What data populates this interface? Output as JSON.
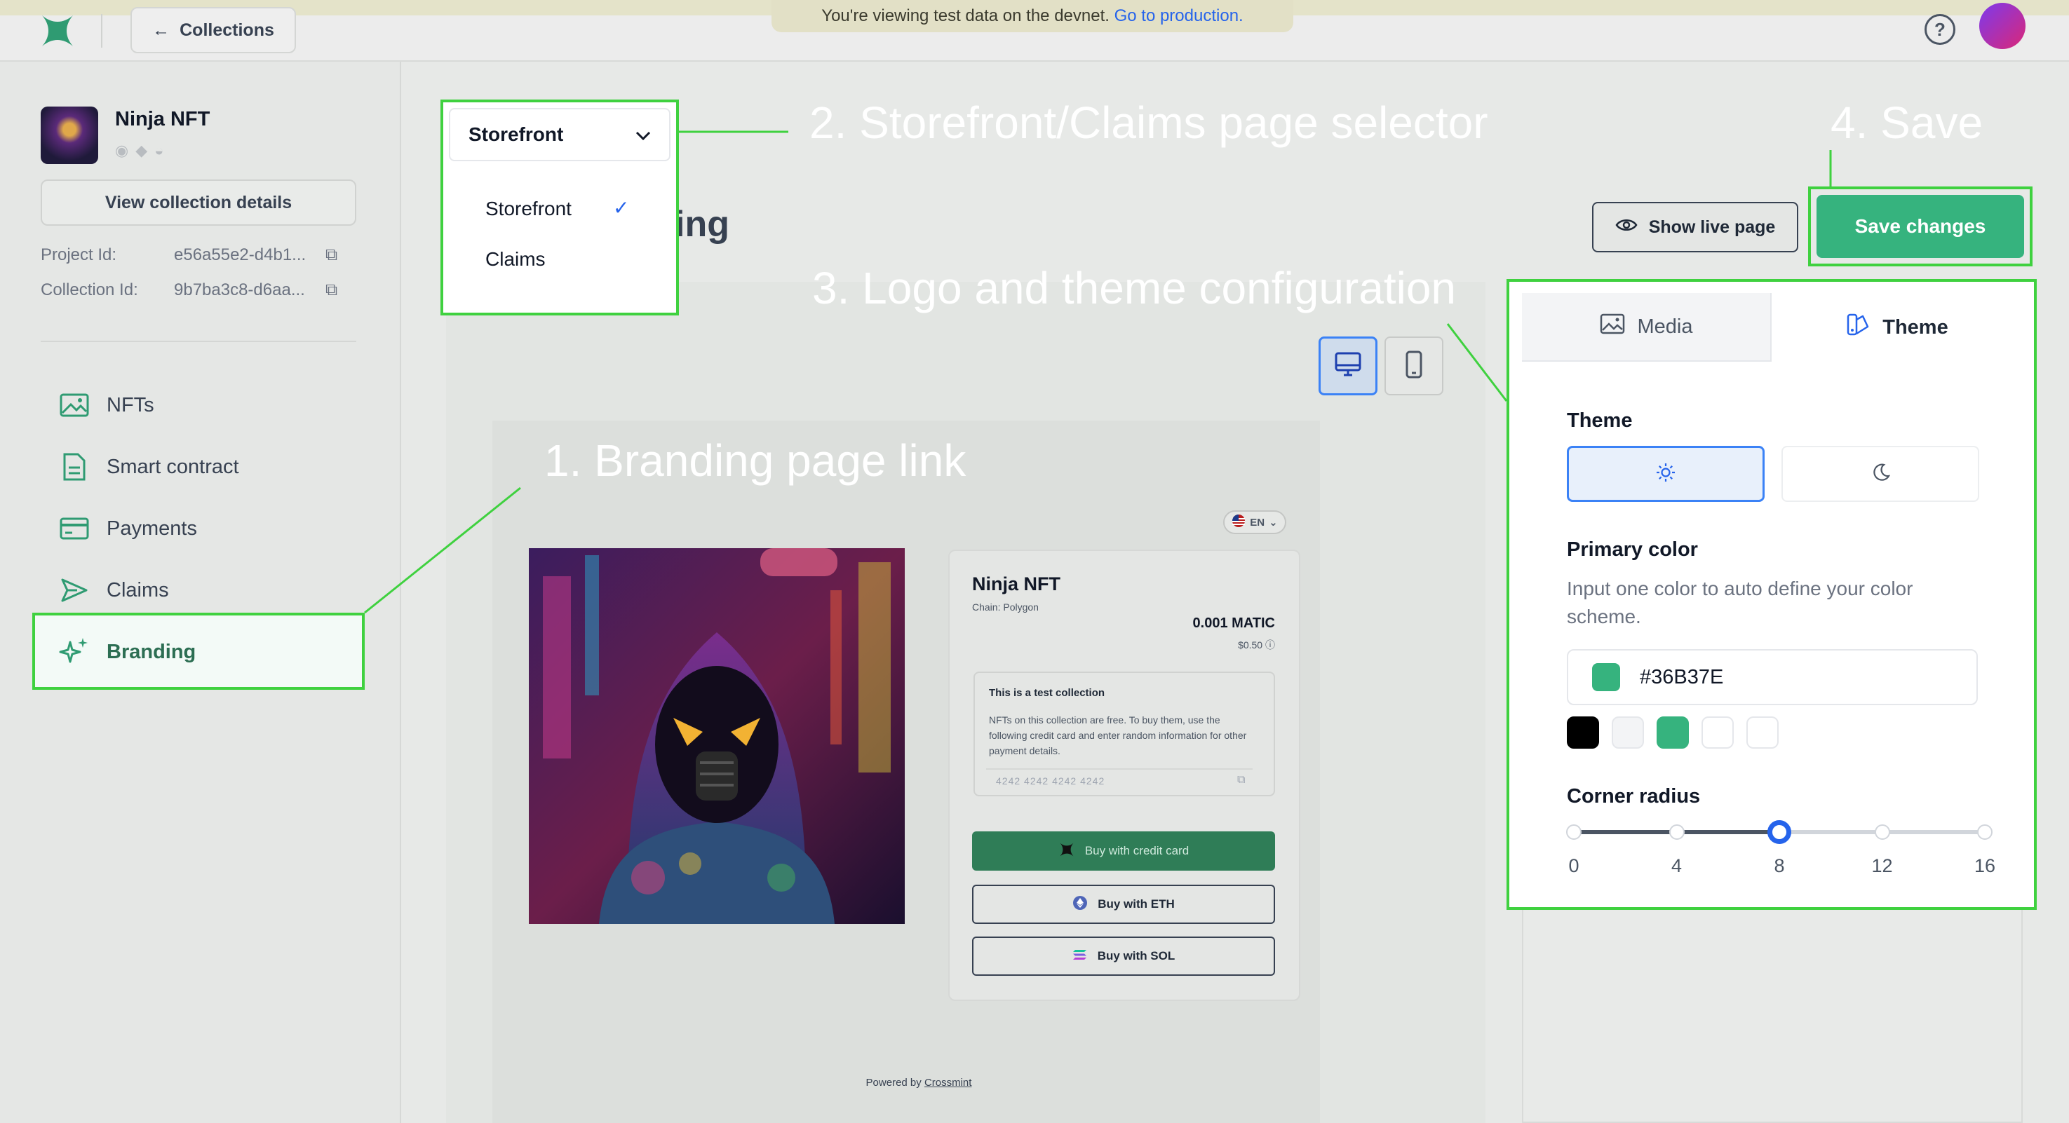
{
  "banner": {
    "text": "You're viewing test data on the devnet.",
    "link": "Go to production."
  },
  "topbar": {
    "back_label": "Collections",
    "help_glyph": "?"
  },
  "collection": {
    "name": "Ninja NFT",
    "view_details": "View collection details",
    "project_id_label": "Project Id:",
    "project_id_value": "e56a55e2-d4b1...",
    "collection_id_label": "Collection Id:",
    "collection_id_value": "9b7ba3c8-d6aa..."
  },
  "sidebar": {
    "items": [
      {
        "label": "NFTs",
        "icon": "image-icon"
      },
      {
        "label": "Smart contract",
        "icon": "file-icon"
      },
      {
        "label": "Payments",
        "icon": "credit-card-icon"
      },
      {
        "label": "Claims",
        "icon": "send-icon"
      },
      {
        "label": "Branding",
        "icon": "sparkles-icon",
        "active": true
      }
    ]
  },
  "main": {
    "title_fragment": "ing",
    "show_live": "Show live page",
    "save": "Save changes"
  },
  "page_selector": {
    "selected": "Storefront",
    "options": [
      "Storefront",
      "Claims"
    ]
  },
  "preview": {
    "lang": "EN",
    "name": "Ninja NFT",
    "chain": "Chain: Polygon",
    "price": "0.001 MATIC",
    "price_usd": "$0.50",
    "test_title": "This is a test collection",
    "test_body": "NFTs on this collection are free. To buy them, use the following credit card and enter random information for other payment details.",
    "test_card": "4242 4242 4242 4242",
    "buy_cc": "Buy with credit card",
    "buy_eth": "Buy with ETH",
    "buy_sol": "Buy with SOL",
    "powered_prefix": "Powered by",
    "powered_brand": "Crossmint"
  },
  "config": {
    "tabs": {
      "media": "Media",
      "theme": "Theme"
    },
    "theme_label": "Theme",
    "primary_label": "Primary color",
    "primary_hint": "Input one color to auto define your color scheme.",
    "primary_value": "#36B37E",
    "presets": [
      "#000000",
      "#F3F4F6",
      "#36B37E",
      "#FFFFFF",
      "#FFFFFF"
    ],
    "radius_label": "Corner radius",
    "radius_ticks": [
      "0",
      "4",
      "8",
      "12",
      "16"
    ],
    "radius_value": 8,
    "radius_max": 16
  },
  "annotations": {
    "a1": "1. Branding page link",
    "a2": "2. Storefront/Claims page selector",
    "a3": "3. Logo and theme configuration",
    "a4": "4. Save"
  },
  "colors": {
    "accent": "#36B37E",
    "highlight": "#3FD13F",
    "link": "#2563EB"
  }
}
